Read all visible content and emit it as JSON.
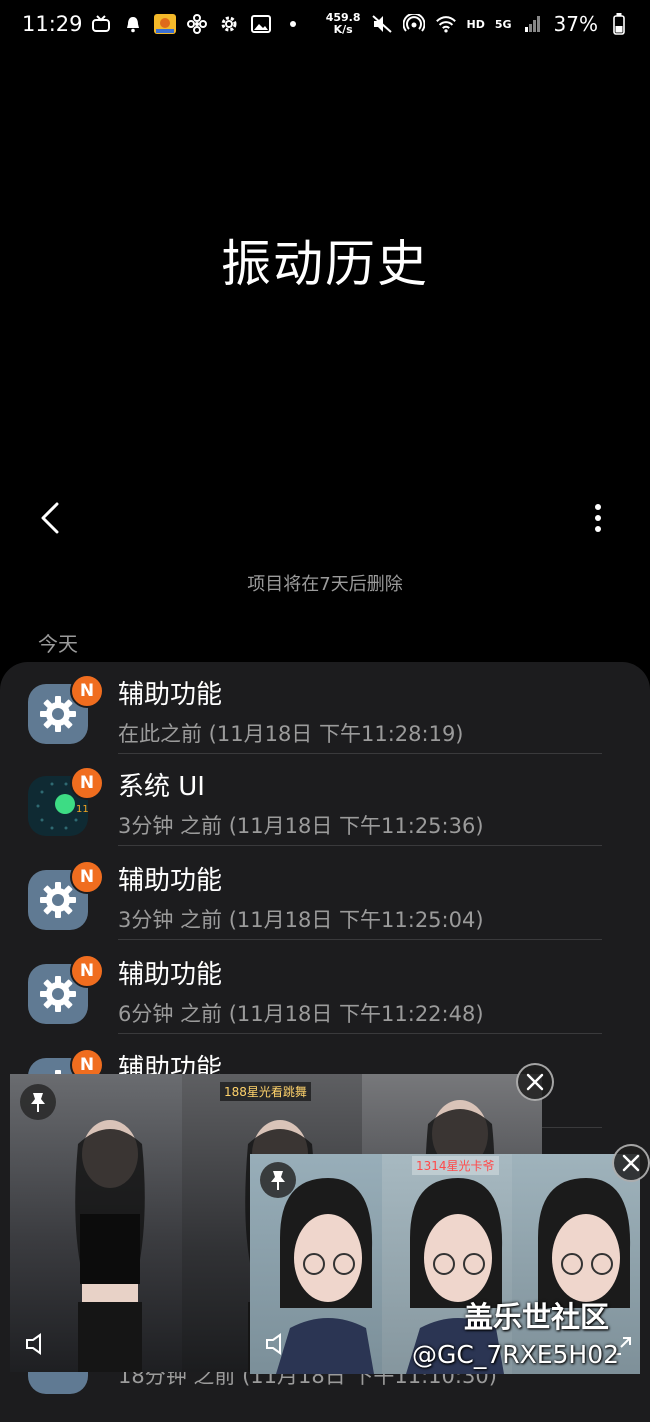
{
  "status_bar": {
    "time": "11:29",
    "net_speed_value": "459.8",
    "net_speed_unit": "K/s",
    "hd": "HD",
    "signal": "5G",
    "battery": "37%"
  },
  "header": {
    "title": "振动历史",
    "back_icon": "chevron-left-icon",
    "more_icon": "more-vertical-icon"
  },
  "notice": "项目将在7天后删除",
  "section": {
    "label": "今天"
  },
  "items": [
    {
      "app": "辅助功能",
      "time": "在此之前 (11月18日 下午11:28:19)",
      "icon": "settings-gear-icon",
      "badge": "N"
    },
    {
      "app": "系统 UI",
      "time": "3分钟 之前 (11月18日 下午11:25:36)",
      "icon": "system-ui-icon",
      "badge": "N",
      "icon_sub": "11"
    },
    {
      "app": "辅助功能",
      "time": "3分钟 之前 (11月18日 下午11:25:04)",
      "icon": "settings-gear-icon",
      "badge": "N"
    },
    {
      "app": "辅助功能",
      "time": "6分钟 之前 (11月18日 下午11:22:48)",
      "icon": "settings-gear-icon",
      "badge": "N"
    },
    {
      "app": "辅助功能",
      "time": "",
      "icon": "settings-gear-icon",
      "badge": "N"
    },
    {
      "app": "",
      "time": "18分钟 之前 (11月18日 下午11:10:30)",
      "icon": "settings-gear-icon",
      "badge": ""
    }
  ],
  "pip_windows": [
    {
      "tag": "188星光看跳舞",
      "pin_icon": "pin-icon",
      "sound_icon": "speaker-icon",
      "close_icon": "close-icon"
    },
    {
      "tag": "1314星光卡爷",
      "pin_icon": "pin-icon",
      "sound_icon": "speaker-icon",
      "close_icon": "close-icon",
      "expand_icon": "expand-icon"
    }
  ],
  "watermark": {
    "line1": "盖乐世社区",
    "line2": "@GC_7RXE5H02"
  },
  "colors": {
    "background": "#000000",
    "card": "#1c1c1e",
    "badge": "#f06d1f",
    "secondary_text": "#9b9b9b"
  }
}
